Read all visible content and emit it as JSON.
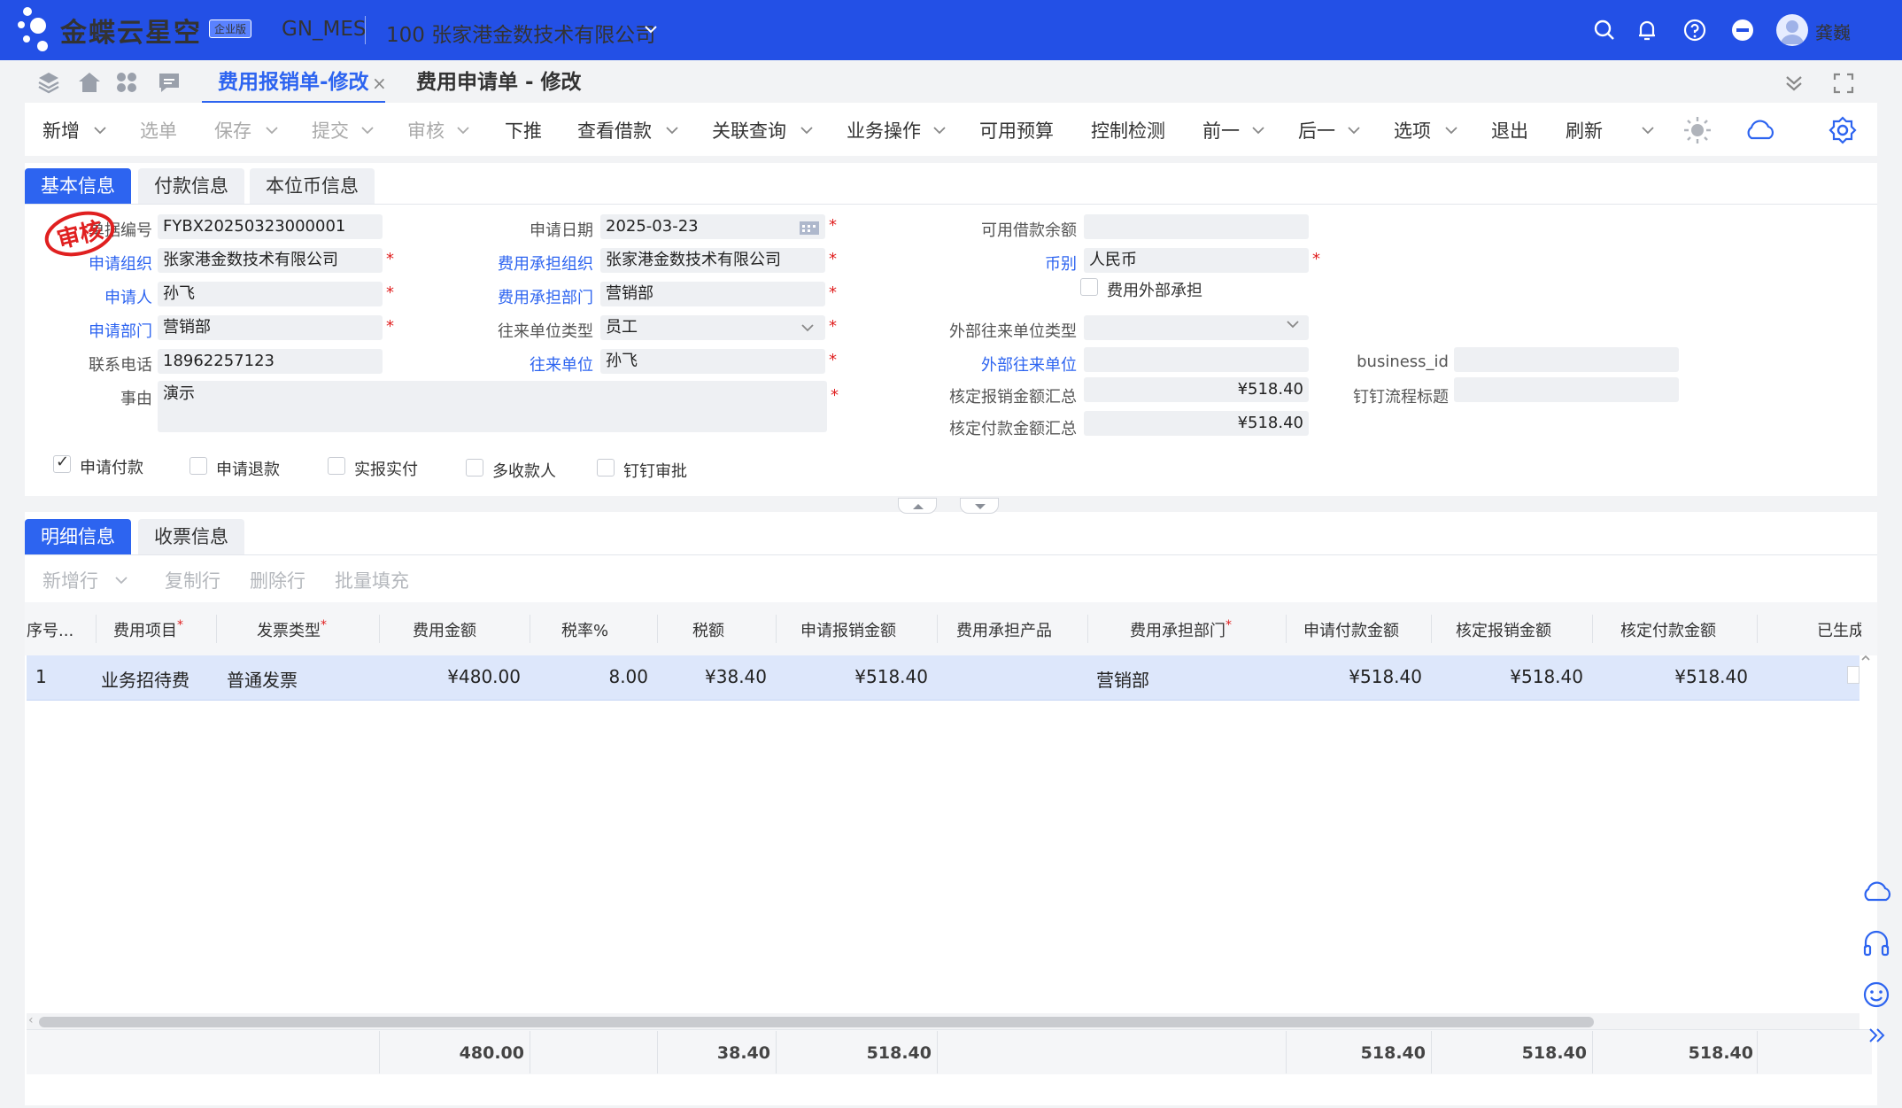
{
  "header": {
    "brand": "金蝶云星空",
    "badge": "企业版",
    "data_center": "GN_MES",
    "org": "100 张家港金数技术有限公司",
    "user_name": "龚巍",
    "accent": "#2350e6"
  },
  "tabs": {
    "active": "费用报销单-修改",
    "second": "费用申请单 - 修改"
  },
  "toolbar": {
    "new": "新增",
    "select": "选单",
    "save": "保存",
    "submit": "提交",
    "audit": "审核",
    "push": "下推",
    "view_loan": "查看借款",
    "linked_query": "关联查询",
    "business_ops": "业务操作",
    "available_budget": "可用预算",
    "control_check": "控制检测",
    "prev": "前一",
    "next": "后一",
    "options": "选项",
    "exit": "退出",
    "refresh": "刷新"
  },
  "head_tabs": [
    "基本信息",
    "付款信息",
    "本位币信息"
  ],
  "stamp": "审核",
  "form": {
    "bill_no_label": "单据编号",
    "bill_no": "FYBX20250323000001",
    "apply_org_label": "申请组织",
    "apply_org": "张家港金数技术有限公司",
    "applicant_label": "申请人",
    "applicant": "孙飞",
    "apply_dept_label": "申请部门",
    "apply_dept": "营销部",
    "phone_label": "联系电话",
    "phone": "18962257123",
    "reason_label": "事由",
    "reason": "演示",
    "apply_date_label": "申请日期",
    "apply_date": "2025-03-23",
    "cost_org_label": "费用承担组织",
    "cost_org": "张家港金数技术有限公司",
    "cost_dept_label": "费用承担部门",
    "cost_dept": "营销部",
    "contact_type_label": "往来单位类型",
    "contact_type": "员工",
    "contact_unit_label": "往来单位",
    "contact_unit": "孙飞",
    "loan_balance_label": "可用借款余额",
    "loan_balance": "",
    "currency_label": "币别",
    "currency": "人民币",
    "external_bear_label": "费用外部承担",
    "ext_contact_type_label": "外部往来单位类型",
    "ext_contact_type": "",
    "ext_contact_label": "外部往来单位",
    "ext_contact": "",
    "approved_reimb_label": "核定报销金额汇总",
    "approved_reimb": "¥518.40",
    "approved_pay_label": "核定付款金额汇总",
    "approved_pay": "¥518.40",
    "business_id_label": "business_id",
    "business_id": "",
    "dingtalk_title_label": "钉钉流程标题",
    "dingtalk_title": ""
  },
  "checkboxes": [
    {
      "label": "申请付款",
      "checked": true
    },
    {
      "label": "申请退款",
      "checked": false
    },
    {
      "label": "实报实付",
      "checked": false
    },
    {
      "label": "多收款人",
      "checked": false
    },
    {
      "label": "钉钉审批",
      "checked": false
    }
  ],
  "detail_tabs": [
    "明细信息",
    "收票信息"
  ],
  "entry_toolbar": {
    "add_row": "新增行",
    "copy_row": "复制行",
    "delete_row": "删除行",
    "batch_fill": "批量填充"
  },
  "grid": {
    "columns": [
      "序号...",
      "费用项目",
      "发票类型",
      "费用金额",
      "税率%",
      "税额",
      "申请报销金额",
      "费用承担产品",
      "费用承担部门",
      "申请付款金额",
      "核定报销金额",
      "核定付款金额",
      "已生成"
    ],
    "rows": [
      {
        "seq": "1",
        "expense_item": "业务招待费",
        "invoice_type": "普通发票",
        "amount": "¥480.00",
        "tax_rate": "8.00",
        "tax": "¥38.40",
        "apply_reimb": "¥518.40",
        "product": "",
        "dept": "营销部",
        "apply_pay": "¥518.40",
        "approved_reimb": "¥518.40",
        "approved_pay": "¥518.40"
      }
    ],
    "totals": {
      "amount": "480.00",
      "tax": "38.40",
      "apply_reimb": "518.40",
      "apply_pay": "518.40",
      "approved_reimb": "518.40",
      "approved_pay": "518.40"
    }
  }
}
